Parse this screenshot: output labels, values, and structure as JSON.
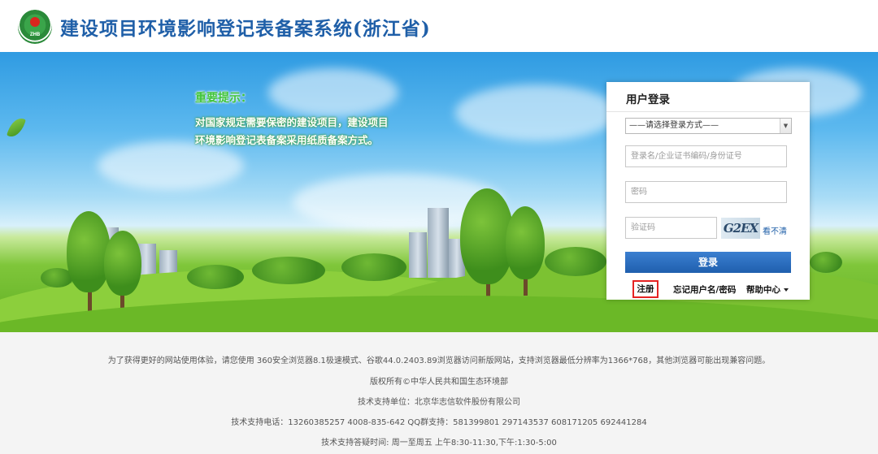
{
  "header": {
    "title": "建设项目环境影响登记表备案系统(浙江省)",
    "logo_text": "ZHB"
  },
  "notice": {
    "title": "重要提示：",
    "line1": "对国家规定需要保密的建设项目，建设项目",
    "line2": "环境影响登记表备案采用纸质备案方式。"
  },
  "login": {
    "title": "用户登录",
    "method_selected": "——请选择登录方式——",
    "username_placeholder": "登录名/企业证书编码/身份证号",
    "password_placeholder": "密码",
    "captcha_placeholder": "验证码",
    "captcha_text": "G2EX",
    "captcha_refresh": "看不清",
    "submit_label": "登录",
    "register_label": "注册",
    "forgot_label": "忘记用户名/密码",
    "help_label": "帮助中心"
  },
  "footer": {
    "browser_tip": "为了获得更好的网站使用体验，请您使用 360安全浏览器8.1极速模式、谷歌44.0.2403.89浏览器访问新版网站，支持浏览器最低分辨率为1366*768，其他浏览器可能出现兼容问题。",
    "copyright": "版权所有©中华人民共和国生态环境部",
    "support_unit": "技术支持单位：北京华志信软件股份有限公司",
    "support_phone": "技术支持电话：13260385257    4008-835-642    QQ群支持：581399801    297143537    608171205    692441284",
    "support_hours": "技术支持答疑时间: 周一至周五 上午8:30-11:30,下午:1:30-5:00"
  },
  "colors": {
    "title_blue": "#1f5fa8",
    "login_button": "#2a6fc4",
    "register_highlight": "#e52222"
  }
}
